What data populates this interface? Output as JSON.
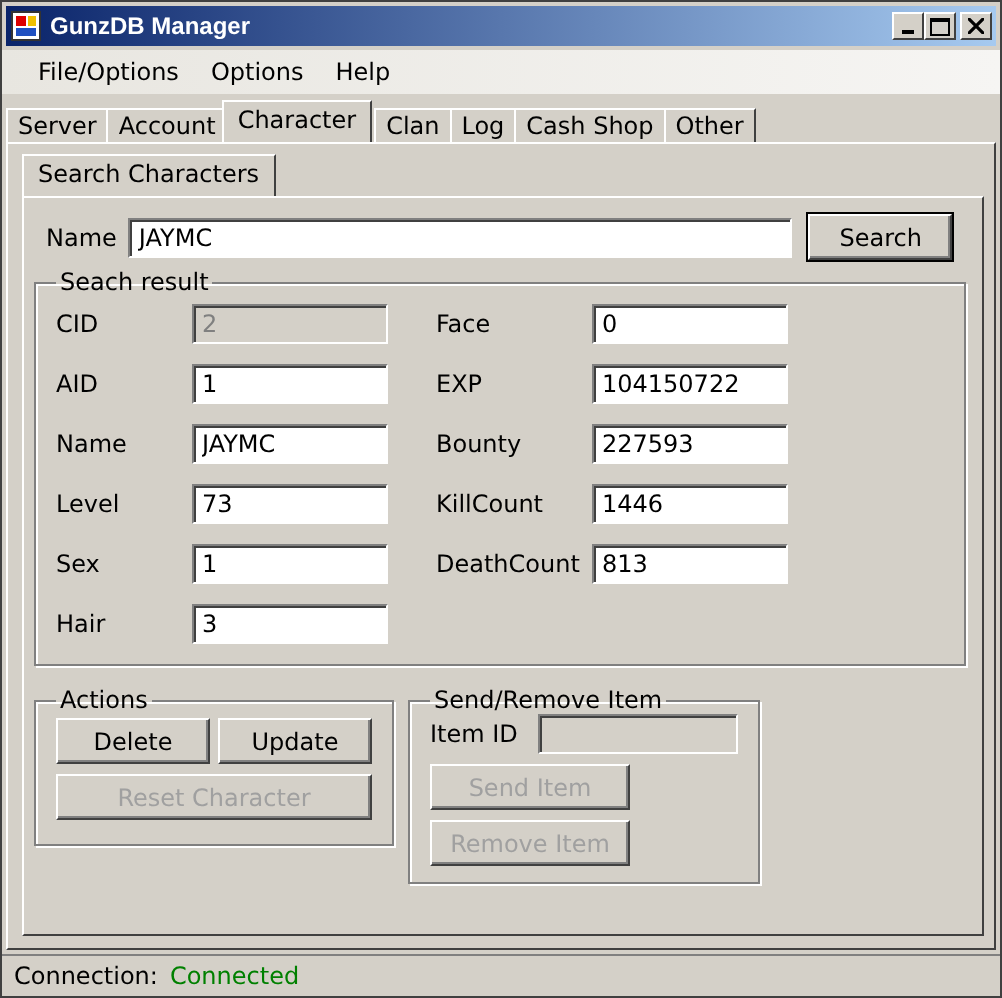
{
  "window": {
    "title": "GunzDB Manager"
  },
  "menu": [
    "File/Options",
    "Options",
    "Help"
  ],
  "tabs": [
    {
      "label": "Server",
      "selected": false
    },
    {
      "label": "Account",
      "selected": false
    },
    {
      "label": "Character",
      "selected": true
    },
    {
      "label": "Clan",
      "selected": false
    },
    {
      "label": "Log",
      "selected": false
    },
    {
      "label": "Cash Shop",
      "selected": false
    },
    {
      "label": "Other",
      "selected": false
    }
  ],
  "subtabs": [
    {
      "label": "Search Characters",
      "selected": true
    }
  ],
  "search": {
    "label": "Name",
    "value": "JAYMC",
    "button": "Search"
  },
  "result": {
    "title": "Seach result",
    "fields": [
      {
        "label": "CID",
        "value": "2",
        "disabled": true
      },
      {
        "label": "Face",
        "value": "0",
        "disabled": false
      },
      {
        "label": "AID",
        "value": "1",
        "disabled": false
      },
      {
        "label": "EXP",
        "value": "104150722",
        "disabled": false
      },
      {
        "label": "Name",
        "value": "JAYMC",
        "disabled": false
      },
      {
        "label": "Bounty",
        "value": "227593",
        "disabled": false
      },
      {
        "label": "Level",
        "value": "73",
        "disabled": false
      },
      {
        "label": "KillCount",
        "value": "1446",
        "disabled": false
      },
      {
        "label": "Sex",
        "value": "1",
        "disabled": false
      },
      {
        "label": "DeathCount",
        "value": "813",
        "disabled": false
      },
      {
        "label": "Hair",
        "value": "3",
        "disabled": false
      }
    ]
  },
  "actions": {
    "title": "Actions",
    "rows": [
      [
        {
          "label": "Delete",
          "disabled": false
        },
        {
          "label": "Update",
          "disabled": false
        }
      ],
      [
        {
          "label": "Reset Character",
          "disabled": true
        }
      ]
    ]
  },
  "send_remove": {
    "title": "Send/Remove Item",
    "field_label": "Item ID",
    "field_disabled": true,
    "buttons": [
      {
        "label": "Send Item",
        "disabled": true
      },
      {
        "label": "Remove Item",
        "disabled": true
      }
    ]
  },
  "status": {
    "label": "Connection:",
    "value": "Connected"
  }
}
